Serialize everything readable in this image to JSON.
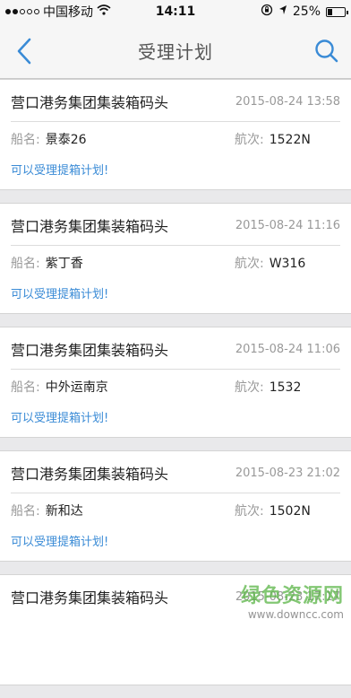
{
  "statusbar": {
    "carrier": "中国移动",
    "time": "14:11",
    "battery_pct": "25%",
    "battery_level": 0.25
  },
  "nav": {
    "title": "受理计划"
  },
  "labels": {
    "ship": "船名:",
    "voyage": "航次:"
  },
  "cards": [
    {
      "company": "营口港务集团集装箱码头",
      "time": "2015-08-24 13:58",
      "ship": "景泰26",
      "voyage": "1522N",
      "status": "可以受理提箱计划!"
    },
    {
      "company": "营口港务集团集装箱码头",
      "time": "2015-08-24 11:16",
      "ship": "紫丁香",
      "voyage": "W316",
      "status": "可以受理提箱计划!"
    },
    {
      "company": "营口港务集团集装箱码头",
      "time": "2015-08-24 11:06",
      "ship": "中外运南京",
      "voyage": "1532",
      "status": "可以受理提箱计划!"
    },
    {
      "company": "营口港务集团集装箱码头",
      "time": "2015-08-23 21:02",
      "ship": "新和达",
      "voyage": "1502N",
      "status": "可以受理提箱计划!"
    },
    {
      "company": "营口港务集团集装箱码头",
      "time": "2015-08-23 17:17",
      "ship": "",
      "voyage": "",
      "status": ""
    }
  ],
  "watermark": {
    "line1": "绿色资源网",
    "line2": "www.downcc.com"
  },
  "colors": {
    "accent": "#3a8bd6",
    "background": "#e9e9eb"
  }
}
